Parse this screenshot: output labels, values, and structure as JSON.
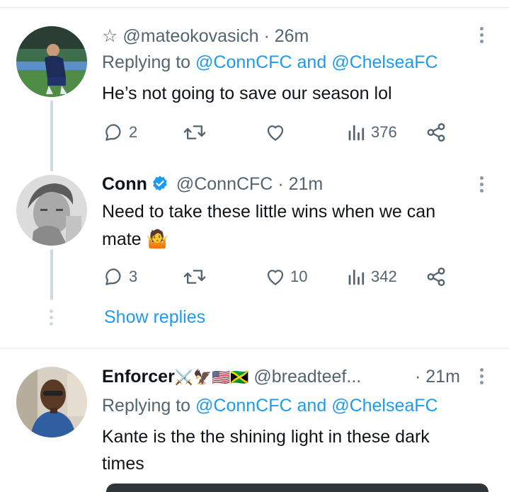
{
  "tweets": [
    {
      "star": "☆",
      "handle": "@mateokovasich",
      "sep": "·",
      "time": "26m",
      "replying_prefix": "Replying to",
      "mention1": "@ConnCFC",
      "and": "and",
      "mention2": "@ChelseaFC",
      "text_line1": "He’s not going to save our season lol",
      "replies": "2",
      "retweets": "",
      "likes": "",
      "views": "376"
    },
    {
      "name": "Conn",
      "handle": "@ConnCFC",
      "sep": "·",
      "time": "21m",
      "text_line1": "Need to take these little wins when we can",
      "text_line2": "mate 🤷",
      "replies": "3",
      "retweets": "",
      "likes": "10",
      "views": "342"
    },
    {
      "name": "Enforcer",
      "name_emojis": "⚔️🦅🇺🇸🇯🇲",
      "handle": "@breadteef...",
      "sep": "·",
      "time": "21m",
      "replying_prefix": "Replying to",
      "mention1": "@ConnCFC",
      "and": "and",
      "mention2": "@ChelseaFC",
      "text_line1": "Kante is the the shining light in these dark",
      "text_line2": "times"
    }
  ],
  "show_replies": "Show replies",
  "colors": {
    "accent": "#1d9bf0",
    "secondary": "#536471",
    "verified": "#1d9bf0",
    "thread": "#cfd9de"
  },
  "icons": [
    "reply-icon",
    "retweet-icon",
    "like-icon",
    "views-icon",
    "share-icon",
    "more-icon",
    "verified-badge-icon"
  ]
}
